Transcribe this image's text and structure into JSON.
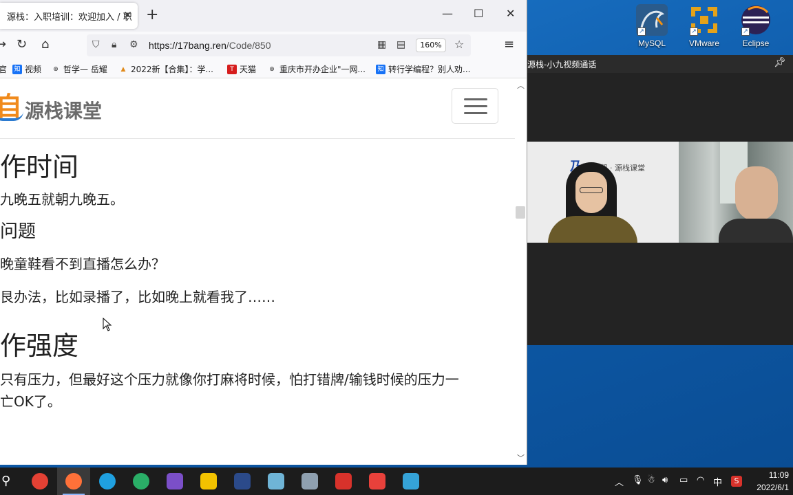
{
  "desktop": {
    "icons": [
      {
        "label": "MySQL",
        "name": "mysql-icon",
        "color": "#2a5b8c"
      },
      {
        "label": "VMware",
        "name": "vmware-icon",
        "color": "#e3a21a"
      },
      {
        "label": "Eclipse",
        "name": "eclipse-icon",
        "color": "#2c2255"
      }
    ]
  },
  "browser": {
    "tab_title": "源栈：入职培训：欢迎加入 / 职",
    "url_host": "https://17bang.ren",
    "url_path": "/Code/850",
    "zoom": "160%",
    "bookmarks": [
      {
        "label": "官",
        "icon": ""
      },
      {
        "label": "视频",
        "icon": "知"
      },
      {
        "label": "哲学— 岳耀",
        "icon": "⊕"
      },
      {
        "label": "2022新【合集】：学...",
        "icon": "▲"
      },
      {
        "label": "天猫",
        "icon": "T"
      },
      {
        "label": "重庆市开办企业\"一网...",
        "icon": "⊕"
      },
      {
        "label": "转行学编程？别人劝...",
        "icon": "知"
      }
    ]
  },
  "site": {
    "logo_mark": "自",
    "logo_text": "源栈课堂"
  },
  "content": {
    "h_work_time": "作时间",
    "p_work_time": "九晚五就朝九晚五。",
    "h_question": "问题",
    "p_question": "晚童鞋看不到直播怎么办？",
    "p_answer": "艮办法，比如录播了，比如晚上就看我了……",
    "h_intensity": "作强度",
    "p_intensity_1": "只有压力，但最好这个压力就像你打麻将时候，怕打错牌/输钱时候的压力一",
    "p_intensity_2": "亡OK了。"
  },
  "videocall": {
    "title": "源栈-小九视频通话",
    "wall_text": "一起帮 · 源栈课堂"
  },
  "taskbar": {
    "apps": [
      {
        "name": "chrome-icon",
        "color": "#e44134"
      },
      {
        "name": "firefox-icon",
        "color": "#ff7139",
        "active": true
      },
      {
        "name": "edge-icon",
        "color": "#1fa0e0"
      },
      {
        "name": "wechat-icon",
        "color": "#2aae67"
      },
      {
        "name": "visual-studio-icon",
        "color": "#7b4fc8"
      },
      {
        "name": "file-explorer-icon",
        "color": "#f2c200"
      },
      {
        "name": "spt-icon",
        "color": "#2b4a8a"
      },
      {
        "name": "notepad-icon",
        "color": "#6fb4d6"
      },
      {
        "name": "image-viewer-icon",
        "color": "#8fa0b0"
      },
      {
        "name": "wps-icon",
        "color": "#d8322b"
      },
      {
        "name": "app-swirl-icon",
        "color": "#e8413b"
      },
      {
        "name": "screen-tool-icon",
        "color": "#35a3d8"
      }
    ],
    "ime": "中",
    "time": "11:09",
    "date": "2022/6/1"
  }
}
